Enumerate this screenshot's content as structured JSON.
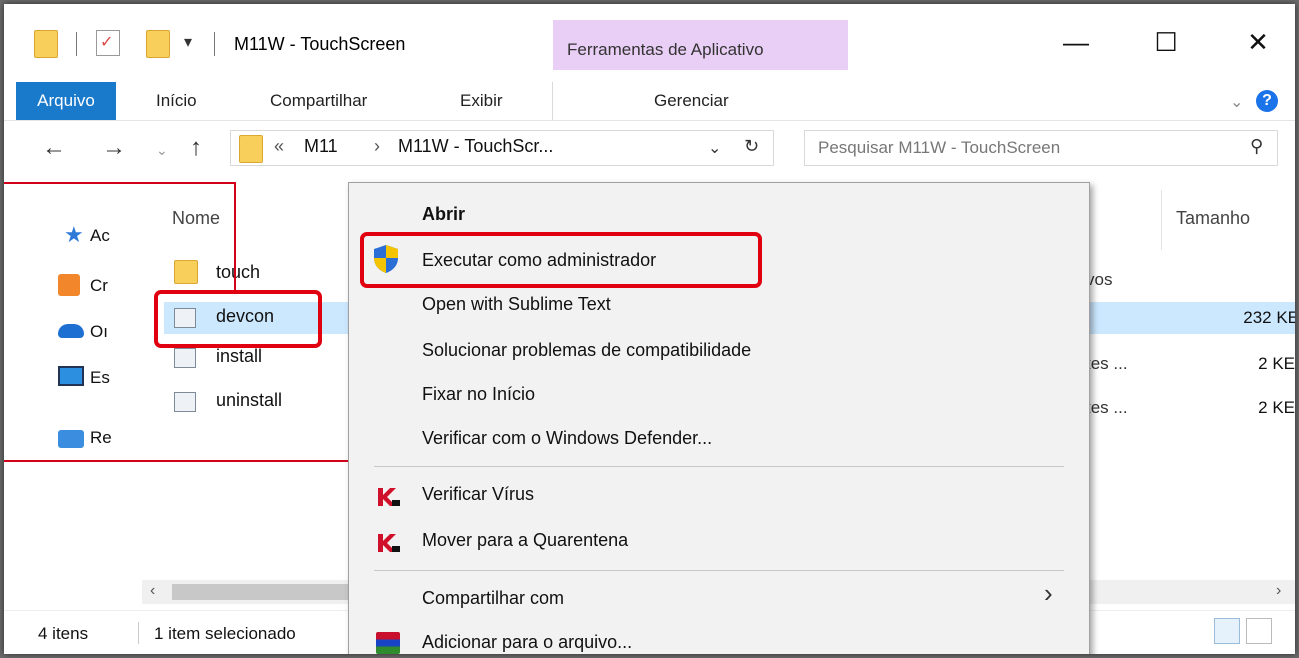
{
  "title_bar": {
    "window_title": "M11W - TouchScreen",
    "context_tools_label": "Ferramentas de Aplicativo",
    "controls": {
      "minimize_icon": "minimize-icon",
      "maximize_icon": "maximize-icon",
      "close_icon": "close-icon"
    }
  },
  "ribbon": {
    "tabs": [
      "Arquivo",
      "Início",
      "Compartilhar",
      "Exibir",
      "Gerenciar"
    ]
  },
  "nav": {
    "crumb_prefix": "«",
    "crumb1": "M11",
    "crumb_sep": "›",
    "crumb2": "M11W - TouchScr...",
    "search_placeholder": "Pesquisar M11W - TouchScreen"
  },
  "sidebar": {
    "items": [
      "Ac",
      "Cr",
      "Oı",
      "Es",
      "Re"
    ]
  },
  "file_list": {
    "columns": {
      "name": "Nome",
      "size": "Tamanho"
    },
    "rows": [
      {
        "name": "touch",
        "type": "vos",
        "size": ""
      },
      {
        "name": "devcon",
        "type": "",
        "size": "232 KE"
      },
      {
        "name": "install",
        "type": "tes ...",
        "size": "2 KE"
      },
      {
        "name": "uninstall",
        "type": "tes ...",
        "size": "2 KE"
      }
    ]
  },
  "status_bar": {
    "item_count": "4 itens",
    "selection": "1 item selecionado"
  },
  "context_menu": {
    "open": "Abrir",
    "run_as_admin": "Executar como administrador",
    "open_sublime": "Open with Sublime Text",
    "troubleshoot": "Solucionar problemas de compatibilidade",
    "pin_start": "Fixar no Início",
    "defender": "Verificar com o Windows Defender...",
    "scan_virus": "Verificar Vírus",
    "quarantine": "Mover para a Quarentena",
    "share_with": "Compartilhar com",
    "add_archive": "Adicionar para o arquivo..."
  },
  "colors": {
    "accent": "#1979ca",
    "highlight": "#e00010",
    "context_tools": "#e9cef5",
    "selection": "#cce8ff"
  }
}
